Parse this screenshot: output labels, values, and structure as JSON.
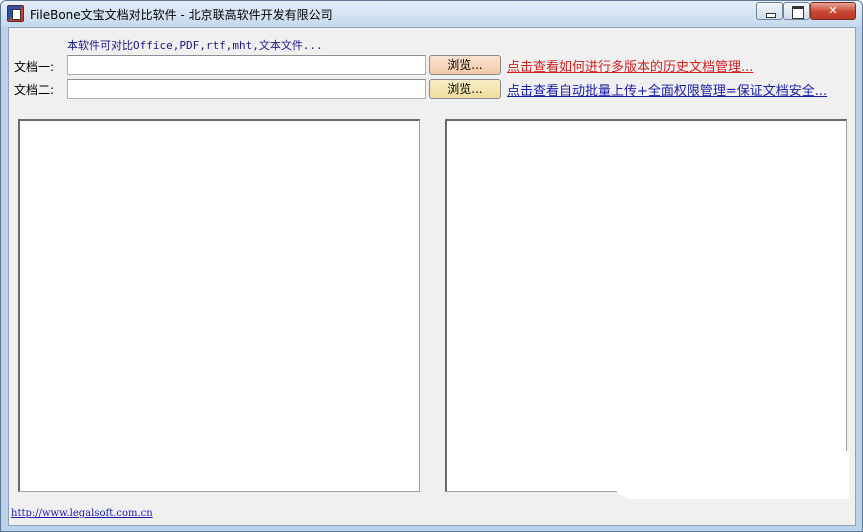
{
  "window": {
    "title": "FileBone文宝文档对比软件 - 北京联高软件开发有限公司"
  },
  "caption_buttons": {
    "close_glyph": "✕"
  },
  "hint": "本软件可对比Office,PDF,rtf,mht,文本文件...",
  "doc1": {
    "label": "文档一:",
    "value": "",
    "browse_label": "浏览..."
  },
  "doc2": {
    "label": "文档二:",
    "value": "",
    "browse_label": "浏览..."
  },
  "links": {
    "history": "点击查看如何进行多版本的历史文档管理...",
    "security": "点击查看自动批量上传+全面权限管理=保证文档安全..."
  },
  "footer": {
    "website": "http://www.legalsoft.com.cn"
  },
  "colors": {
    "link_red": "#d12020",
    "link_blue": "#1a1aa8"
  }
}
